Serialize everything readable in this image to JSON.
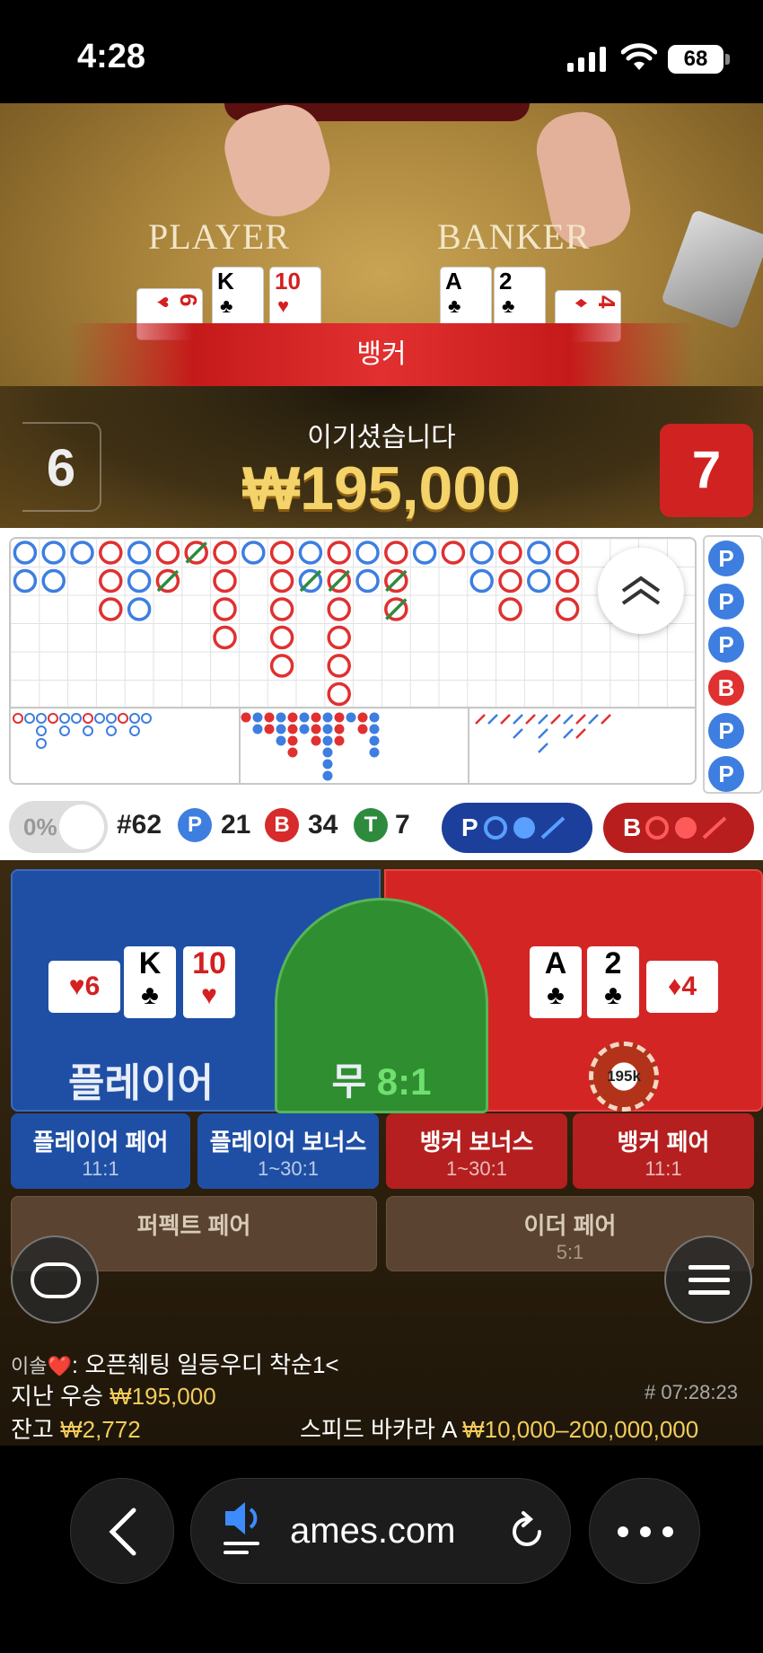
{
  "status_bar": {
    "time": "4:28",
    "battery": "68"
  },
  "table": {
    "player_label": "PLAYER",
    "banker_label": "BANKER",
    "player_cards": [
      {
        "rank": "6",
        "suit": "♥",
        "red": true
      },
      {
        "rank": "K",
        "suit": "♣",
        "red": false
      },
      {
        "rank": "10",
        "suit": "♥",
        "red": true
      }
    ],
    "banker_cards": [
      {
        "rank": "A",
        "suit": "♣",
        "red": false
      },
      {
        "rank": "2",
        "suit": "♣",
        "red": false
      },
      {
        "rank": "4",
        "suit": "♦",
        "red": true
      }
    ]
  },
  "result": {
    "banner": "뱅커",
    "win_label": "이기셨습니다",
    "win_amount": "₩195,000",
    "player_score": "6",
    "banker_score": "7"
  },
  "roadmap": {
    "side_beads": [
      "P",
      "P",
      "P",
      "B",
      "P",
      "P"
    ],
    "colors": {
      "player": "#3d7ee0",
      "banker": "#e03030",
      "tie": "#2e8b3e"
    }
  },
  "stats": {
    "percent": "0%",
    "round": "#62",
    "p_label": "P",
    "p_count": "21",
    "b_label": "B",
    "b_count": "34",
    "t_label": "T",
    "t_count": "7",
    "predict_p": "P",
    "predict_b": "B"
  },
  "bets": {
    "player_label": "플레이어",
    "tie_label": "무",
    "tie_odds": "8:1",
    "chip_amount": "195k",
    "side": [
      {
        "name": "플레이어 페어",
        "odds": "11:1"
      },
      {
        "name": "플레이어 보너스",
        "odds": "1~30:1"
      },
      {
        "name": "뱅커 보너스",
        "odds": "1~30:1"
      },
      {
        "name": "뱅커 페어",
        "odds": "11:1"
      }
    ],
    "perfect_pair": "퍼펙트 페어",
    "either_pair": "이더 페어",
    "either_odds": "5:1"
  },
  "info": {
    "chat_user": "이솔❤️",
    "chat_msg": ": 오픈췌팅 일등우디 착순1<",
    "last_win_label": "지난 우승",
    "last_win_value": "₩195,000",
    "balance_label": "잔고",
    "balance_value": "₩2,772",
    "game_id": "# 07:28:23",
    "table_name": "스피드 바카라 A",
    "limits": "₩10,000–200,000,000"
  },
  "browser": {
    "url": "ames.com"
  }
}
